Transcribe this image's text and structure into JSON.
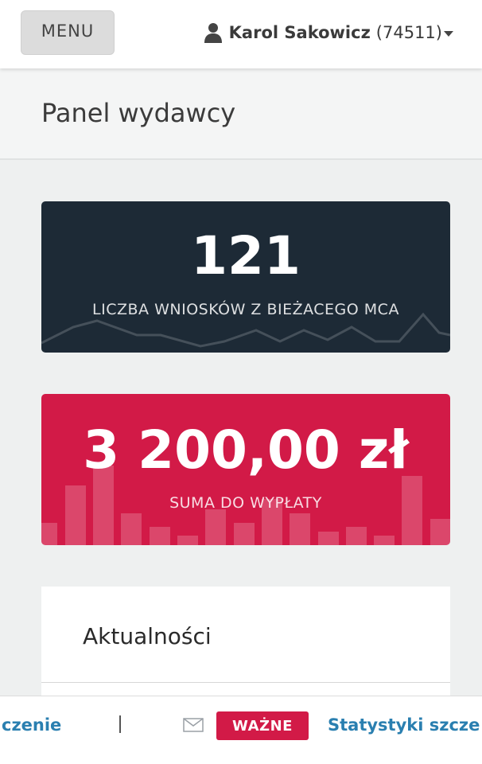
{
  "topbar": {
    "menu_label": "MENU",
    "user_name": "Karol Sakowicz",
    "user_id": "(74511)",
    "user_icon": "user-icon",
    "dropdown_icon": "caret-down-icon"
  },
  "page": {
    "title": "Panel wydawcy"
  },
  "stats": {
    "applications_count": "121",
    "applications_label": "LICZBA WNIOSKÓW Z BIEŻACEGO MCA",
    "payout_amount": "3 200,00 zł",
    "payout_label": "SUMA DO WYPŁATY",
    "dark_color": "#1d2a36",
    "red_color": "#d21a47"
  },
  "news": {
    "title": "Aktualności"
  },
  "ticker": {
    "text_left": "czenie",
    "mail_icon": "envelope-icon",
    "badge": "WAŻNE",
    "text_right": "Statystyki szcze",
    "link_color": "#2a7fb0"
  }
}
